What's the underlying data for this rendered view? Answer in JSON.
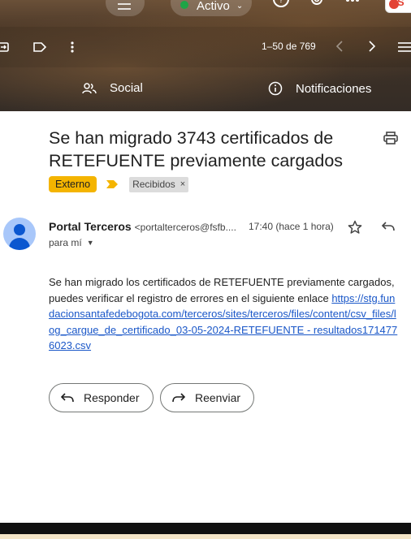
{
  "topbar": {
    "status_label": "Activo",
    "app_badge_text": "S"
  },
  "toolbar": {
    "pager_text": "1–50 de 769"
  },
  "tabs": [
    {
      "label": "Social"
    },
    {
      "label": "Notificaciones"
    }
  ],
  "email": {
    "subject": "Se han migrado 3743 certificados de RETEFUENTE previamente cargados",
    "labels": {
      "external": "Externo",
      "inbox": "Recibidos",
      "inbox_remove": "×"
    },
    "sender_name": "Portal Terceros",
    "sender_email": "<portalterceros@fsfb....",
    "time": "17:40 (hace 1 hora)",
    "to_text": "para mí",
    "body_text": "Se han migrado los certificados de RETEFUENTE previamente cargados, puedes verificar el registro de errores en el siguiente enlace ",
    "body_link": "https://stg.fundacionsantafedebogota.com/terceros/sites/terceros/files/content/csv_files/log_cargue_de_certificado_03-05-2024-RETEFUENTE - resultados1714776023.csv"
  },
  "actions": {
    "reply_label": "Responder",
    "forward_label": "Reenviar"
  },
  "icons": {
    "status_dot_color": "#1ea446",
    "external_label_color": "#f4b400",
    "link_color": "#1a57c8"
  }
}
